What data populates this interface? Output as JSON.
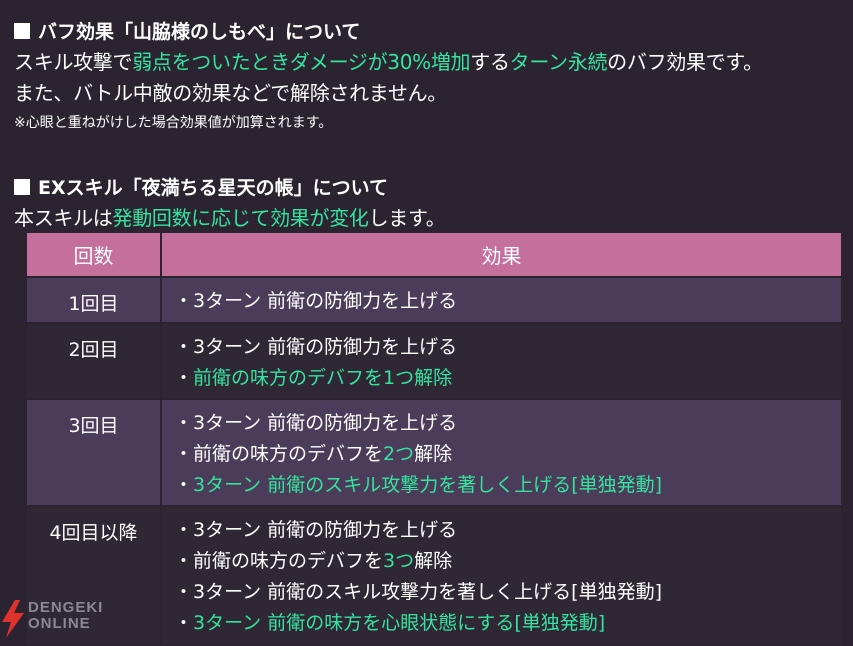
{
  "section1": {
    "heading": "バフ効果「山脇様のしもべ」について",
    "line1": [
      {
        "t": "スキル攻撃で",
        "hl": false
      },
      {
        "t": "弱点をついたときダメージが30%増加",
        "hl": true
      },
      {
        "t": "する",
        "hl": false
      },
      {
        "t": "ターン永続",
        "hl": true
      },
      {
        "t": "のバフ効果です。",
        "hl": false
      }
    ],
    "line2": "また、バトル中敵の効果などで解除されません。",
    "note": "※心眼と重ねがけした場合効果値が加算されます。"
  },
  "section2": {
    "heading": "EXスキル「夜満ちる星天の帳」について",
    "intro": [
      {
        "t": "本スキルは",
        "hl": false
      },
      {
        "t": "発動回数に応じて効果が変化",
        "hl": true
      },
      {
        "t": "します。",
        "hl": false
      }
    ]
  },
  "table": {
    "headers": [
      "回数",
      "効果"
    ],
    "rows": [
      {
        "count": "1回目",
        "effects": [
          [
            {
              "t": "・3ターン 前衛の防御力を上げる",
              "hl": false
            }
          ]
        ]
      },
      {
        "count": "2回目",
        "effects": [
          [
            {
              "t": "・3ターン 前衛の防御力を上げる",
              "hl": false
            }
          ],
          [
            {
              "t": "・",
              "hl": false
            },
            {
              "t": "前衛の味方のデバフを1つ解除",
              "hl": true
            }
          ]
        ]
      },
      {
        "count": "3回目",
        "effects": [
          [
            {
              "t": "・3ターン 前衛の防御力を上げる",
              "hl": false
            }
          ],
          [
            {
              "t": "・前衛の味方のデバフを",
              "hl": false
            },
            {
              "t": "2つ",
              "hl": true
            },
            {
              "t": "解除",
              "hl": false
            }
          ],
          [
            {
              "t": "・",
              "hl": false
            },
            {
              "t": "3ターン 前衛のスキル攻撃力を著しく上げる[単独発動]",
              "hl": true
            }
          ]
        ]
      },
      {
        "count": "4回目以降",
        "effects": [
          [
            {
              "t": "・3ターン 前衛の防御力を上げる",
              "hl": false
            }
          ],
          [
            {
              "t": "・前衛の味方のデバフを",
              "hl": false
            },
            {
              "t": "3つ",
              "hl": true
            },
            {
              "t": "解除",
              "hl": false
            }
          ],
          [
            {
              "t": "・3ターン 前衛のスキル攻撃力を著しく上げる[単独発動]",
              "hl": false
            }
          ],
          [
            {
              "t": "・",
              "hl": false
            },
            {
              "t": "3ターン 前衛の味方を心眼状態にする[単独発動]",
              "hl": true
            }
          ]
        ]
      }
    ]
  },
  "watermark": {
    "line1": "DENGEKI",
    "line2": "ONLINE"
  },
  "colors": {
    "background": "#2b2430",
    "highlight": "#34e3a0",
    "header": "#c56f9c",
    "row_alt": "#4b3c59"
  }
}
